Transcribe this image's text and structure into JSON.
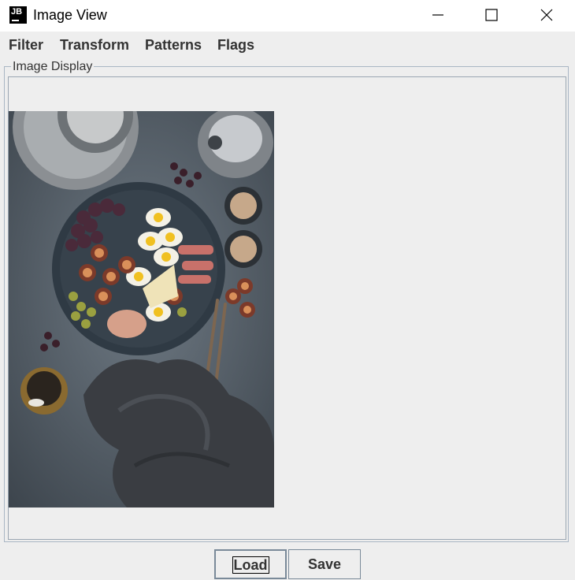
{
  "window": {
    "title": "Image View",
    "icon_text": "JB"
  },
  "menu": {
    "items": [
      "Filter",
      "Transform",
      "Patterns",
      "Flags"
    ]
  },
  "panel": {
    "legend": "Image Display"
  },
  "image": {
    "subject": "food-platter-photo"
  },
  "buttons": {
    "load": "Load",
    "save": "Save"
  }
}
